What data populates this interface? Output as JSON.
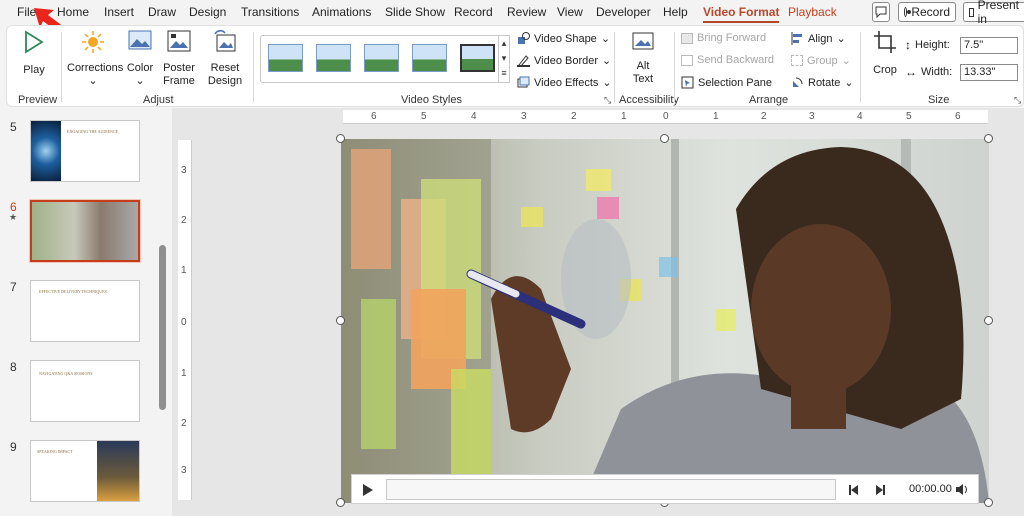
{
  "tabs": [
    "File",
    "Home",
    "Insert",
    "Draw",
    "Design",
    "Transitions",
    "Animations",
    "Slide Show",
    "Record",
    "Review",
    "View",
    "Developer",
    "Help",
    "Video Format",
    "Playback"
  ],
  "topbar": {
    "record_label": "Record",
    "present_label": "Present in"
  },
  "ribbon": {
    "preview": {
      "play": "Play",
      "group": "Preview"
    },
    "adjust": {
      "corrections": "Corrections",
      "color": "Color",
      "poster_frame": "Poster Frame",
      "reset_design": "Reset Design",
      "group": "Adjust"
    },
    "video_styles": {
      "video_shape": "Video Shape",
      "video_border": "Video Border",
      "video_effects": "Video Effects",
      "group": "Video Styles"
    },
    "accessibility": {
      "alt_text": "Alt Text",
      "group": "Accessibility"
    },
    "arrange": {
      "bring_forward": "Bring Forward",
      "send_backward": "Send Backward",
      "selection_pane": "Selection Pane",
      "align": "Align",
      "group_btn": "Group",
      "rotate": "Rotate",
      "group": "Arrange"
    },
    "size": {
      "crop": "Crop",
      "height_label": "Height:",
      "height_value": "7.5\"",
      "width_label": "Width:",
      "width_value": "13.33\"",
      "group": "Size"
    }
  },
  "slides": [
    {
      "num": "5",
      "title": "ENGAGING THE AUDIENCE"
    },
    {
      "num": "6",
      "title": "",
      "marker": "★"
    },
    {
      "num": "7",
      "title": "EFFECTIVE DELIVERY TECHNIQUES"
    },
    {
      "num": "8",
      "title": "NAVIGATING Q&A SESSIONS"
    },
    {
      "num": "9",
      "title": "SPEAKING IMPACT"
    }
  ],
  "ruler": {
    "h": [
      "6",
      "5",
      "4",
      "3",
      "2",
      "1",
      "0",
      "1",
      "2",
      "3",
      "4",
      "5",
      "6"
    ],
    "v": [
      "3",
      "2",
      "1",
      "0",
      "1",
      "2",
      "3"
    ]
  },
  "player": {
    "time": "00:00.00"
  },
  "colors": {
    "accent": "#b7472a",
    "playback": "#c43e1c",
    "annotation_arrow": "#e8261c"
  }
}
